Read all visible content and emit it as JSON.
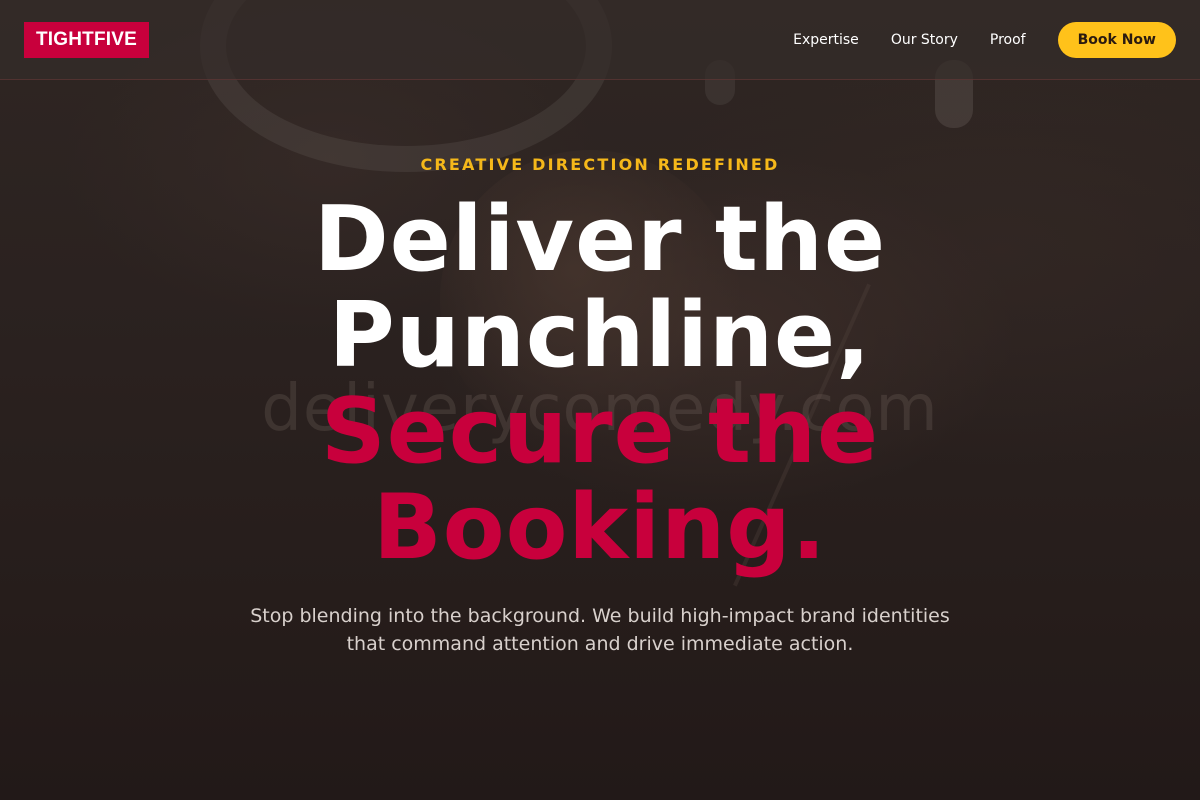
{
  "header": {
    "logo": "TIGHTFIVE",
    "nav": [
      "Expertise",
      "Our Story",
      "Proof"
    ],
    "cta_label": "Book Now"
  },
  "hero": {
    "eyebrow": "CREATIVE DIRECTION REDEFINED",
    "headline_line1": "Deliver the",
    "headline_line2": "Punchline,",
    "headline_line3": "Secure the",
    "headline_line4": "Booking.",
    "subtext": "Stop blending into the background. We build high-impact brand identities that command attention and drive immediate action.",
    "background_text": "deliverycomedy.com"
  },
  "colors": {
    "brand_red": "#c8003c",
    "accent_yellow": "#ffc21a",
    "eyebrow_gold": "#f5b81a",
    "background": "#2a211f"
  }
}
